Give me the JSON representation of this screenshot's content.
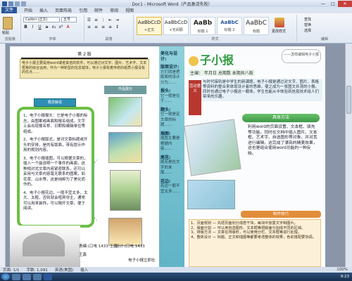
{
  "window": {
    "title": "Doc1 - Microsoft Word（产品激活失败）"
  },
  "tabs": {
    "file": "文件",
    "items": [
      "开始",
      "插入",
      "页面布局",
      "引用",
      "邮件",
      "审阅",
      "视图"
    ]
  },
  "ribbon": {
    "paste": "粘贴",
    "font_name": "Calibri (正文)",
    "font_size": "五号",
    "groups": [
      "剪贴板",
      "字体",
      "段落",
      "样式",
      "编辑"
    ],
    "styles": [
      {
        "sample": "AaBbCcD",
        "name": "+正文"
      },
      {
        "sample": "AaBbCcD",
        "name": "+无间隔"
      },
      {
        "sample": "AaBb",
        "name": "标题 1"
      },
      {
        "sample": "AaBbC",
        "name": "标题 2"
      },
      {
        "sample": "AaBbC",
        "name": "标题"
      }
    ],
    "change_styles": "更改样式",
    "edit_cmds": [
      "查找",
      "替换",
      "选择"
    ]
  },
  "left_page": {
    "header": "第 2 版",
    "intro": "电子小报主要是用word或者其他的软件，可以通过对文字、图片、艺术字、文本框等的综合运用，作为一种新型的信息载体，电子小报有着传统的纸质小报没有的优点……",
    "banner_left": "概念解说",
    "banner_right": "作品展示",
    "points": [
      "1、电子小报报头：它是电子小报的标志，由图案或画面和报名组成，文字上会出现报名称、日期和编辑单位等组成。",
      "2、电子小报版式，是对文章标题或开头的安排，是的有版面，带有提示作用的规划内容。",
      "3、电子小报插图，可以根据文章的，插入一个能说明一个事件的画面，这种相对式文章内容紧密联系，还可以采用与文章内容毫无联系的图案，如花草、山水等，这是纯粹为了美化而作的。",
      "4、电子小报花边，一般不宜太多，太大、太粗，否则就会喧宾夺主，通常可以用来装饰，可以隔开文章，便于阅读。"
    ],
    "credit_1": "责编:(口电 1433 王鑫",
    "credit_2": "王鑫",
    "credit_3": "设计:(口电 1433",
    "credit_4": "电子小报立即社"
  },
  "right_page": {
    "toc": [
      {
        "head": "美化与设计:",
        "body": ""
      },
      {
        "head": "版面设计:",
        "body": "它们就是把版面的设计分为……"
      },
      {
        "head": "报头:",
        "body": "它一般是位于……"
      },
      {
        "head": "题头:",
        "body": "它一般是定文章的标题……"
      },
      {
        "head": "插图:",
        "body": "插图主要是根据内容……"
      },
      {
        "head": "尾花:",
        "body": "尾花是在文字的末尾……"
      },
      {
        "head": "花边:",
        "body": "花边一般不宜太多……"
      }
    ],
    "mast_title": "子小报",
    "mast_sub": "主编： 年月日 总期数 本期共八版",
    "motto": "——怎样编辑电子小报",
    "label": "活动意义",
    "lead_text": "与时代接轨是中学生的新课题，电子小报是通过对文字、图片、表格等资料的整合来体现设计者的思维，使之成为一张图文并茂的小报。同时也通过电子小报这一载体，学生也能从中体验到信息技术给人们带来的乐趣。",
    "method_head": "具体方法",
    "method_text": "利用word的页面设置、文本框、填充等功能，同时在文档中插入图片、文本框、艺术字、自选图形等对象，并对其进行编辑，这完成了漂亮的精美效果，这也是组合使用word功能的一种反映。",
    "notes_head": "制作技巧",
    "notes": [
      "1、页面规划 — 先把页面划分成若干块，每块中放置文字和图片。",
      "2、版面分割 — 可以用自选图形、文本框等把版面分割成不同的区域。",
      "3、排版方法 — 文章在排版时，可以使用分栏、文本框等进行处理。",
      "4、整体设计 — 标题、正文和插图等都要考虑整体的效果，色彩搭配要协调。"
    ]
  },
  "status": {
    "page": "页面: 1/1",
    "words": "字数: 1,091",
    "lang": "英语(美国)",
    "mode": "插入",
    "zoom": "100%"
  },
  "taskbar": {
    "clock": "9:23"
  }
}
